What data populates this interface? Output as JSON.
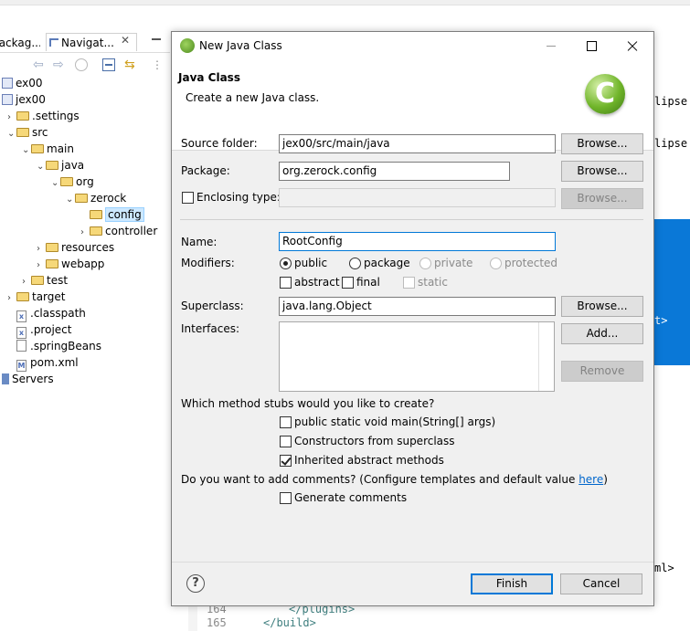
{
  "navigator": {
    "tabs": {
      "packages": "Packag...",
      "navigator": "Navigat..."
    },
    "tree": [
      {
        "label": "ex00",
        "indent": 0,
        "icon": "project",
        "twisty": ""
      },
      {
        "label": "jex00",
        "indent": 0,
        "icon": "project",
        "twisty": ""
      },
      {
        "label": ".settings",
        "indent": 1,
        "icon": "folder",
        "twisty": ">"
      },
      {
        "label": "src",
        "indent": 1,
        "icon": "folder",
        "twisty": "v"
      },
      {
        "label": "main",
        "indent": 2,
        "icon": "folder",
        "twisty": "v"
      },
      {
        "label": "java",
        "indent": 3,
        "icon": "folder",
        "twisty": "v"
      },
      {
        "label": "org",
        "indent": 4,
        "icon": "folder",
        "twisty": "v"
      },
      {
        "label": "zerock",
        "indent": 5,
        "icon": "folder",
        "twisty": "v"
      },
      {
        "label": "config",
        "indent": 6,
        "icon": "folder",
        "twisty": "",
        "selected": true
      },
      {
        "label": "controller",
        "indent": 6,
        "icon": "folder",
        "twisty": ">"
      },
      {
        "label": "resources",
        "indent": 3,
        "icon": "folder",
        "twisty": ">"
      },
      {
        "label": "webapp",
        "indent": 3,
        "icon": "folder",
        "twisty": ">"
      },
      {
        "label": "test",
        "indent": 2,
        "icon": "folder",
        "twisty": ">"
      },
      {
        "label": "target",
        "indent": 1,
        "icon": "folder",
        "twisty": ">"
      },
      {
        "label": ".classpath",
        "indent": 1,
        "icon": "xfile",
        "twisty": ""
      },
      {
        "label": ".project",
        "indent": 1,
        "icon": "xfile",
        "twisty": ""
      },
      {
        "label": ".springBeans",
        "indent": 1,
        "icon": "file",
        "twisty": ""
      },
      {
        "label": "pom.xml",
        "indent": 1,
        "icon": "mfile",
        "twisty": ""
      },
      {
        "label": "Servers",
        "indent": 0,
        "icon": "server",
        "twisty": ""
      }
    ]
  },
  "editor_bg": {
    "right_text_1": "lipse.",
    "right_text_2": "lipse.c",
    "blue_text": "t>",
    "right_text_3": "ml>",
    "line_164_num": "164",
    "line_164_code": "</plugins>",
    "line_165_num": "165",
    "line_165_code": "</build>"
  },
  "dialog": {
    "title": "New Java Class",
    "header": {
      "title": "Java Class",
      "description": "Create a new Java class."
    },
    "source_folder": {
      "label": "Source folder:",
      "value": "jex00/src/main/java",
      "browse": "Browse..."
    },
    "package": {
      "label": "Package:",
      "value": "org.zerock.config",
      "browse": "Browse..."
    },
    "enclosing": {
      "label": "Enclosing type:",
      "value": "",
      "browse": "Browse..."
    },
    "name": {
      "label": "Name:",
      "value": "RootConfig"
    },
    "modifiers": {
      "label": "Modifiers:",
      "public": "public",
      "package": "package",
      "private": "private",
      "protected": "protected",
      "abstract": "abstract",
      "final": "final",
      "static": "static"
    },
    "superclass": {
      "label": "Superclass:",
      "value": "java.lang.Object",
      "browse": "Browse..."
    },
    "interfaces": {
      "label": "Interfaces:",
      "add": "Add...",
      "remove": "Remove"
    },
    "stubs": {
      "question": "Which method stubs would you like to create?",
      "main": "public static void main(String[] args)",
      "constructors": "Constructors from superclass",
      "inherited": "Inherited abstract methods"
    },
    "comments": {
      "question_prefix": "Do you want to add comments? (Configure templates and default value ",
      "link": "here",
      "question_suffix": ")",
      "generate": "Generate comments"
    },
    "footer": {
      "finish": "Finish",
      "cancel": "Cancel",
      "help": "?"
    }
  }
}
